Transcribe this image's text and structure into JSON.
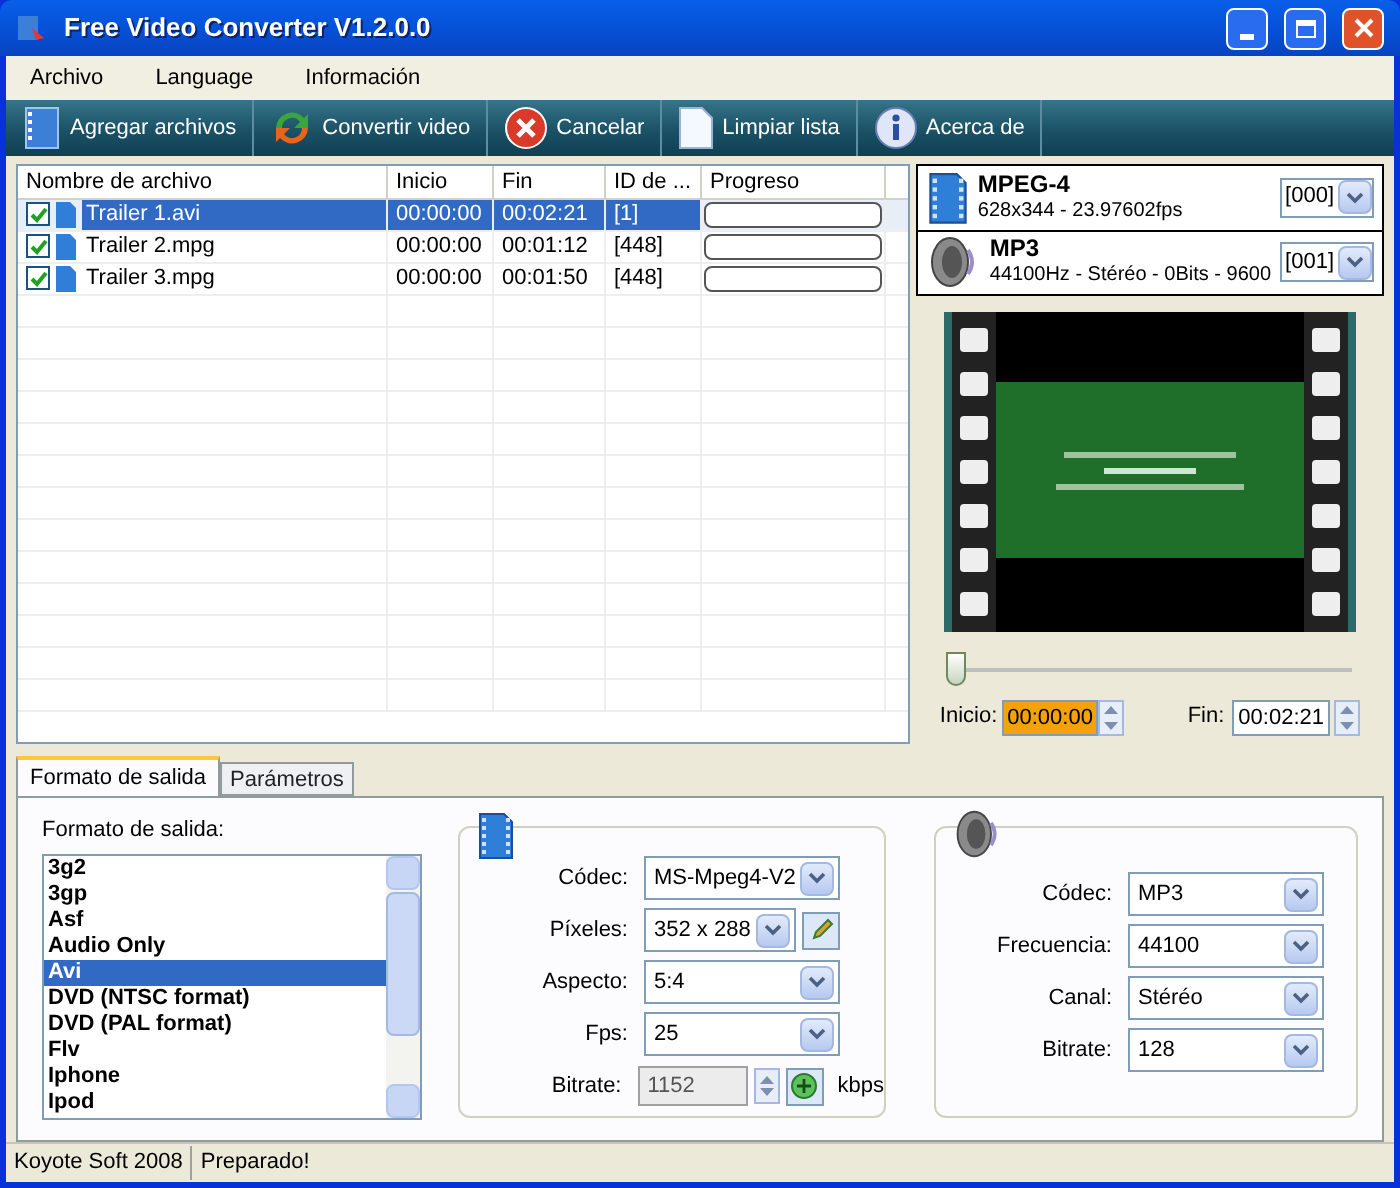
{
  "window": {
    "title": "Free Video Converter V1.2.0.0"
  },
  "menu": [
    "Archivo",
    "Language",
    "Información"
  ],
  "toolbar": [
    {
      "label": "Agregar archivos",
      "kind": "add"
    },
    {
      "label": "Convertir video",
      "kind": "convert"
    },
    {
      "label": "Cancelar",
      "kind": "cancel"
    },
    {
      "label": "Limpiar lista",
      "kind": "clear"
    },
    {
      "label": "Acerca de",
      "kind": "about"
    }
  ],
  "table": {
    "columns": [
      "Nombre de archivo",
      "Inicio",
      "Fin",
      "ID de ...",
      "Progreso"
    ],
    "rows": [
      {
        "name": "Trailer 1.avi",
        "start": "00:00:00",
        "end": "00:02:21",
        "id": "[1]",
        "level": 0,
        "checked": true,
        "selected": true
      },
      {
        "name": "Trailer 2.mpg",
        "start": "00:00:00",
        "end": "00:01:12",
        "id": "[448]",
        "level": 0,
        "checked": true,
        "selected": false
      },
      {
        "name": "Trailer 3.mpg",
        "start": "00:00:00",
        "end": "00:01:50",
        "id": "[448]",
        "level": 0,
        "checked": true,
        "selected": false
      }
    ]
  },
  "streams": [
    {
      "kind": "video",
      "title": "MPEG-4",
      "detail": "628x344 - 23.97602fps",
      "track": "[000]"
    },
    {
      "kind": "audio",
      "title": "MP3",
      "detail": "44100Hz - Stéréo - 0Bits - 9600",
      "track": "[001]"
    }
  ],
  "player": {
    "level": 0.02,
    "start_label": "Inicio:",
    "start": "00:00:00",
    "end_label": "Fin:",
    "end": "00:02:21"
  },
  "tabs": [
    {
      "label": "Formato de salida",
      "selected": true
    },
    {
      "label": "Parámetros",
      "selected": false
    }
  ],
  "formats": {
    "label": "Formato de salida:",
    "items": [
      {
        "label": "3g2",
        "selected": false
      },
      {
        "label": "3gp",
        "selected": false
      },
      {
        "label": "Asf",
        "selected": false
      },
      {
        "label": "Audio Only",
        "selected": false
      },
      {
        "label": "Avi",
        "selected": true
      },
      {
        "label": "DVD (NTSC format)",
        "selected": false
      },
      {
        "label": "DVD (PAL format)",
        "selected": false
      },
      {
        "label": "Flv",
        "selected": false
      },
      {
        "label": "Iphone",
        "selected": false
      },
      {
        "label": "Ipod",
        "selected": false
      }
    ]
  },
  "video_settings": [
    {
      "label": "Códec:",
      "value": "MS-Mpeg4-V2",
      "kind": "select"
    },
    {
      "label": "Píxeles:",
      "value": "352 x 288",
      "kind": "select_button"
    },
    {
      "label": "Aspecto:",
      "value": "5:4",
      "kind": "select"
    },
    {
      "label": "Fps:",
      "value": "25",
      "kind": "select"
    },
    {
      "label": "Bitrate:",
      "value": "1152",
      "kind": "spinner",
      "unit": "kbps"
    }
  ],
  "audio_settings": [
    {
      "label": "Códec:",
      "value": "MP3",
      "kind": "select"
    },
    {
      "label": "Frecuencia:",
      "value": "44100",
      "kind": "select"
    },
    {
      "label": "Canal:",
      "value": "Stéréo",
      "kind": "select"
    },
    {
      "label": "Bitrate:",
      "value": "128",
      "kind": "select"
    }
  ],
  "status_bar": [
    "Koyote Soft 2008",
    "Preparado!"
  ]
}
